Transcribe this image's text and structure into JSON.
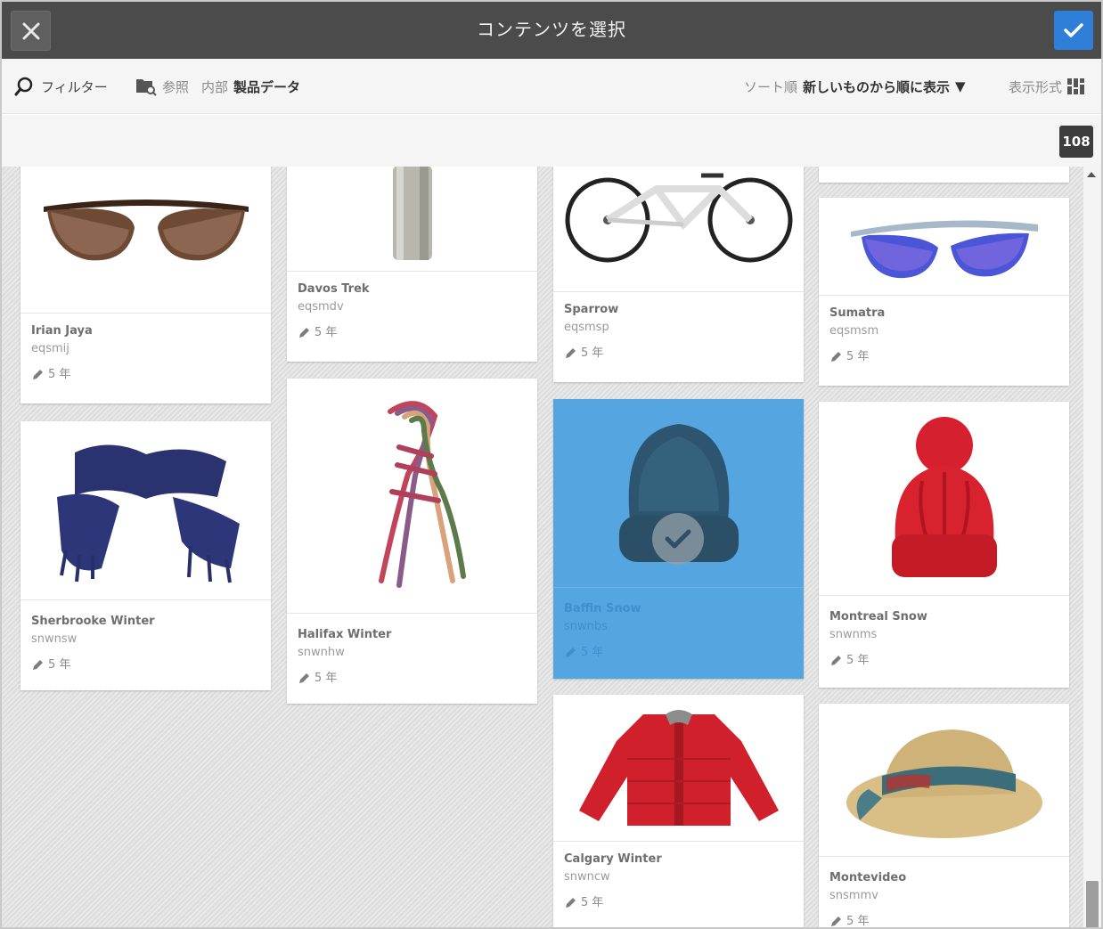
{
  "dialog": {
    "title": "コンテンツを選択",
    "close_icon": "close-icon",
    "confirm_icon": "check-icon"
  },
  "toolbar": {
    "filter_label": "フィルター",
    "browse_label": "参照",
    "location_prefix": "内部",
    "location_value": "製品データ",
    "sort_label": "ソート順",
    "sort_value": "新しいものから順に表示",
    "sort_arrow": "▼",
    "view_label": "表示形式"
  },
  "result_count": "108",
  "cards": [
    {
      "name": "Irian Jaya",
      "code": "eqsmij",
      "age": "5 年",
      "selected": false
    },
    {
      "name": "Sherbrooke Winter",
      "code": "snwnsw",
      "age": "5 年",
      "selected": false
    },
    {
      "name": "Davos Trek",
      "code": "eqsmdv",
      "age": "5 年",
      "selected": false
    },
    {
      "name": "Halifax Winter",
      "code": "snwnhw",
      "age": "5 年",
      "selected": false
    },
    {
      "name": "Sparrow",
      "code": "eqsmsp",
      "age": "5 年",
      "selected": false
    },
    {
      "name": "Baffin Snow",
      "code": "snwnbs",
      "age": "5 年",
      "selected": true
    },
    {
      "name": "Calgary Winter",
      "code": "snwncw",
      "age": "5 年",
      "selected": false
    },
    {
      "name": "Sumatra",
      "code": "eqsmsm",
      "age": "5 年",
      "selected": false
    },
    {
      "name": "Montreal Snow",
      "code": "snwnms",
      "age": "5 年",
      "selected": false
    },
    {
      "name": "Montevideo",
      "code": "snsmmv",
      "age": "5 年",
      "selected": false
    }
  ],
  "colors": {
    "titlebar": "#4b4b4b",
    "confirm": "#2f7fd8",
    "selected": "#55a5e0"
  }
}
